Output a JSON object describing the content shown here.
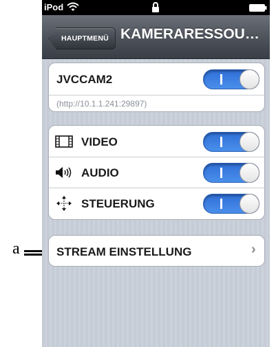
{
  "status_bar": {
    "carrier": "iPod",
    "wifi_icon": "wifi-icon",
    "lock_icon": "lock-icon",
    "battery_icon": "battery-icon"
  },
  "nav": {
    "back_label": "HAUPTMENÜ",
    "title": "KAMERARESSOU…"
  },
  "camera": {
    "name": "JVCCAM2",
    "url": "(http://10.1.1.241:29897)",
    "enabled": true
  },
  "resources": [
    {
      "label": "VIDEO",
      "icon": "film-icon",
      "enabled": true
    },
    {
      "label": "AUDIO",
      "icon": "speaker-icon",
      "enabled": true
    },
    {
      "label": "STEUERUNG",
      "icon": "move-arrows-icon",
      "enabled": true
    }
  ],
  "stream_settings": {
    "label": "STREAM EINSTELLUNG",
    "chevron": "›"
  },
  "callout": {
    "letter": "a"
  },
  "colors": {
    "toggle_on": "#3a7ee3",
    "nav_bar": "#4e535c",
    "background": "#c8cfd8"
  }
}
